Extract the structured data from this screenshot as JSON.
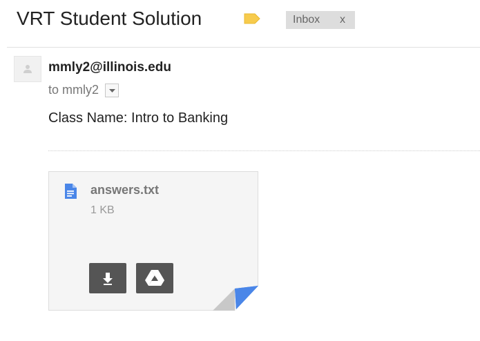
{
  "email": {
    "subject": "VRT Student Solution",
    "label_chip": {
      "text": "Inbox",
      "remove": "x"
    },
    "label_tag_color": "#f7cb4d",
    "sender": "mmly2@illinois.edu",
    "to_line": "to mmly2",
    "body": "Class Name: Intro to Banking"
  },
  "attachment": {
    "filename": "answers.txt",
    "size": "1 KB",
    "icon": "text-document-icon",
    "icon_color": "#4a86e8",
    "actions": [
      "download-icon",
      "google-drive-icon"
    ],
    "corner_color": "#4a86e8"
  }
}
